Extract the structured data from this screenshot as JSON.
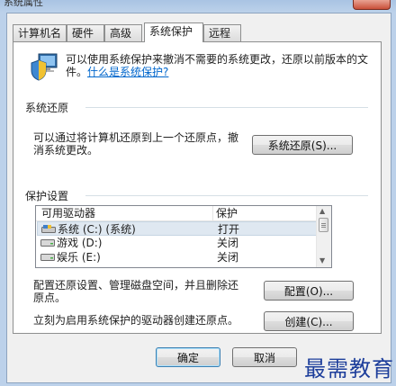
{
  "window": {
    "title": "系统属性"
  },
  "tabs": [
    {
      "label": "计算机名"
    },
    {
      "label": "硬件"
    },
    {
      "label": "高级"
    },
    {
      "label": "系统保护",
      "active": true
    },
    {
      "label": "远程"
    }
  ],
  "intro": {
    "text": "可以使用系统保护来撤消不需要的系统更改，还原以前版本的文件。",
    "link": "什么是系统保护?"
  },
  "restore": {
    "group_title": "系统还原",
    "description": "可以通过将计算机还原到上一个还原点，撤消系统更改。",
    "button_label": "系统还原(S)..."
  },
  "protection": {
    "group_title": "保护设置",
    "columns": [
      "可用驱动器",
      "保护"
    ],
    "drives": [
      {
        "name": "系统 (C:) (系统)",
        "status": "打开",
        "selected": true,
        "icon": "system-drive-icon"
      },
      {
        "name": "游戏 (D:)",
        "status": "关闭",
        "icon": "drive-icon"
      },
      {
        "name": "娱乐 (E:)",
        "status": "关闭",
        "icon": "drive-icon"
      }
    ],
    "configure_text": "配置还原设置、管理磁盘空间，并且删除还原点。",
    "configure_button": "配置(O)...",
    "create_text": "立刻为启用系统保护的驱动器创建还原点。",
    "create_button": "创建(C)..."
  },
  "footer": {
    "ok_label": "确定",
    "cancel_label": "取消"
  },
  "watermark": {
    "text": "最需教育"
  },
  "colors": {
    "link": "#0066cc",
    "selection": "#dfe8f1",
    "watermark": "#1d3e9b"
  }
}
